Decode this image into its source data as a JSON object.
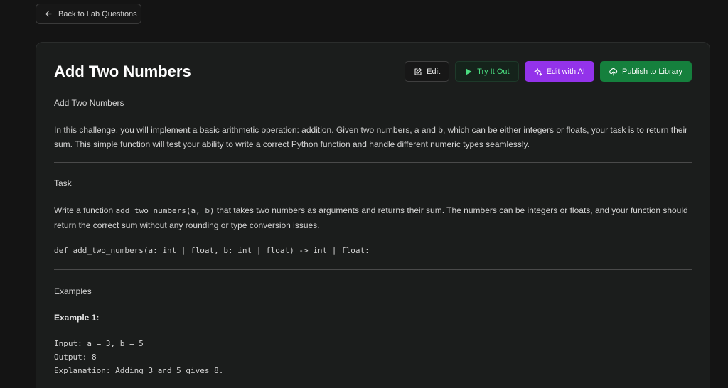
{
  "back_button": {
    "label": "Back to Lab Questions",
    "icon": "arrow-left-icon"
  },
  "page_title": "Add Two Numbers",
  "actions": {
    "edit": "Edit",
    "try_it_out": "Try It Out",
    "edit_with_ai": "Edit with AI",
    "publish": "Publish to Library"
  },
  "colors": {
    "background": "#141414",
    "card": "#1b1d1c",
    "try_green": "#4ade80",
    "ai_purple": "#9333ea",
    "publish_green": "#15803d"
  },
  "body": {
    "subtitle": "Add Two Numbers",
    "intro": "In this challenge, you will implement a basic arithmetic operation: addition. Given two numbers, a and b, which can be either integers or floats, your task is to return their sum. This simple function will test your ability to write a correct Python function and handle different numeric types seamlessly.",
    "task_heading": "Task",
    "task_text_before": "Write a function ",
    "task_code": "add_two_numbers(a, b)",
    "task_text_after": " that takes two numbers as arguments and returns their sum. The numbers can be integers or floats, and your function should return the correct sum without any rounding or type conversion issues.",
    "signature": "def add_two_numbers(a: int | float, b: int | float) -> int | float:",
    "examples_heading": "Examples",
    "example1_title": "Example 1:",
    "example1_input": "Input: a = 3, b = 5",
    "example1_output": "Output: 8",
    "example1_explanation": "Explanation: Adding 3 and 5 gives 8."
  }
}
